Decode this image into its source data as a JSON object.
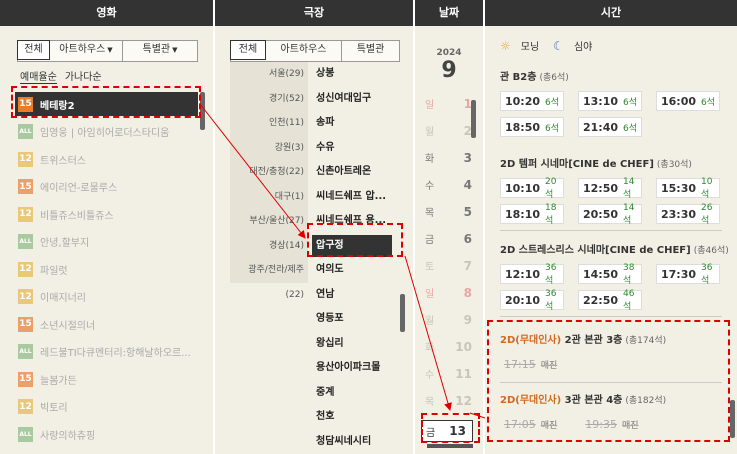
{
  "headers": {
    "movie": "영화",
    "theater": "극장",
    "date": "날짜",
    "time": "시간"
  },
  "movie_tabs": [
    {
      "label": "전체"
    },
    {
      "label": "아트하우스"
    },
    {
      "label": "특별관"
    }
  ],
  "movie_sort": {
    "booking": "예매율순",
    "alpha": "가나다순"
  },
  "movies": [
    {
      "age": "15",
      "title": "베테랑2"
    },
    {
      "age": "ALL",
      "title": "임영웅 | 아임히어로더스타디움"
    },
    {
      "age": "12",
      "title": "트위스터스"
    },
    {
      "age": "15",
      "title": "에이리언-로물루스"
    },
    {
      "age": "12",
      "title": "비틀쥬스비틀쥬스"
    },
    {
      "age": "ALL",
      "title": "안녕,할부지"
    },
    {
      "age": "12",
      "title": "파일럿"
    },
    {
      "age": "12",
      "title": "이매지너리"
    },
    {
      "age": "15",
      "title": "소년시절의너"
    },
    {
      "age": "ALL",
      "title": "레드불TI다큐멘터리:항해날하오르..."
    },
    {
      "age": "15",
      "title": "늘봄가든"
    },
    {
      "age": "12",
      "title": "빅토리"
    },
    {
      "age": "ALL",
      "title": "사랑의하츄핑"
    }
  ],
  "theater_tabs": [
    {
      "label": "전체"
    },
    {
      "label": "아트하우스"
    },
    {
      "label": "특별관"
    }
  ],
  "theaters": [
    {
      "region": "서울(29)",
      "name": "상봉"
    },
    {
      "region": "경기(52)",
      "name": "성신여대입구"
    },
    {
      "region": "인천(11)",
      "name": "송파"
    },
    {
      "region": "강원(3)",
      "name": "수유"
    },
    {
      "region": "대전/충청(22)",
      "name": "신촌아트레온"
    },
    {
      "region": "대구(1)",
      "name": "씨네드쉐프 압..."
    },
    {
      "region": "부산/울산(27)",
      "name": "씨네드쉐프 용..."
    },
    {
      "region": "경상(14)",
      "name": "압구정"
    },
    {
      "region": "광주/전라/제주(22)",
      "name": "여의도"
    },
    {
      "region": "",
      "name": "연남"
    },
    {
      "region": "",
      "name": "영등포"
    },
    {
      "region": "",
      "name": "왕십리"
    },
    {
      "region": "",
      "name": "용산아이파크몰"
    },
    {
      "region": "",
      "name": "중계"
    },
    {
      "region": "",
      "name": "천호"
    },
    {
      "region": "",
      "name": "청담씨네시티"
    }
  ],
  "date": {
    "year": "2024",
    "month": "9",
    "days": [
      {
        "dow": "일",
        "day": "1",
        "type": "sun"
      },
      {
        "dow": "월",
        "day": "2",
        "type": "dim"
      },
      {
        "dow": "화",
        "day": "3",
        "type": "norm"
      },
      {
        "dow": "수",
        "day": "4",
        "type": "norm"
      },
      {
        "dow": "목",
        "day": "5",
        "type": "norm"
      },
      {
        "dow": "금",
        "day": "6",
        "type": "norm"
      },
      {
        "dow": "토",
        "day": "7",
        "type": "dim"
      },
      {
        "dow": "일",
        "day": "8",
        "type": "sun"
      },
      {
        "dow": "월",
        "day": "9",
        "type": "dim"
      },
      {
        "dow": "화",
        "day": "10",
        "type": "dim"
      },
      {
        "dow": "수",
        "day": "11",
        "type": "dim"
      },
      {
        "dow": "목",
        "day": "12",
        "type": "dim"
      }
    ],
    "selected": {
      "dow": "금",
      "day": "13"
    }
  },
  "time_legend": {
    "morning": "모닝",
    "night": "심야"
  },
  "sections": [
    {
      "name": "관 B2층",
      "count": "(총6석)",
      "times": [
        {
          "t": "10:20",
          "s": "6석"
        },
        {
          "t": "13:10",
          "s": "6석"
        },
        {
          "t": "16:00",
          "s": "6석"
        },
        {
          "t": "18:50",
          "s": "6석"
        },
        {
          "t": "21:40",
          "s": "6석"
        }
      ]
    },
    {
      "name": "2D 템퍼 시네마[CINE de CHEF]",
      "count": "(총30석)",
      "times": [
        {
          "t": "10:10",
          "s": "20석"
        },
        {
          "t": "12:50",
          "s": "14석"
        },
        {
          "t": "15:30",
          "s": "10석"
        },
        {
          "t": "18:10",
          "s": "18석"
        },
        {
          "t": "20:50",
          "s": "14석"
        },
        {
          "t": "23:30",
          "s": "26석"
        }
      ]
    },
    {
      "name": "2D 스트레스리스 시네마[CINE de CHEF]",
      "count": "(총46석)",
      "times": [
        {
          "t": "12:10",
          "s": "36석"
        },
        {
          "t": "14:50",
          "s": "38석"
        },
        {
          "t": "17:30",
          "s": "36석"
        },
        {
          "t": "20:10",
          "s": "36석"
        },
        {
          "t": "22:50",
          "s": "46석"
        }
      ]
    },
    {
      "hl": "2D(무대인사)",
      "name": " 2관 본관 3층",
      "count": "(총174석)",
      "times": [
        {
          "t": "17:15",
          "s": "매진"
        }
      ]
    },
    {
      "hl": "2D(무대인사)",
      "name": " 3관 본관 4층",
      "count": "(총182석)",
      "times": [
        {
          "t": "17:05",
          "s": "매진"
        },
        {
          "t": "19:35",
          "s": "매진"
        }
      ]
    }
  ],
  "colors": {
    "age15": "#e9a06b",
    "age12": "#e9c87a",
    "ageALL": "#a9c9a0",
    "accent": "#d00000"
  }
}
